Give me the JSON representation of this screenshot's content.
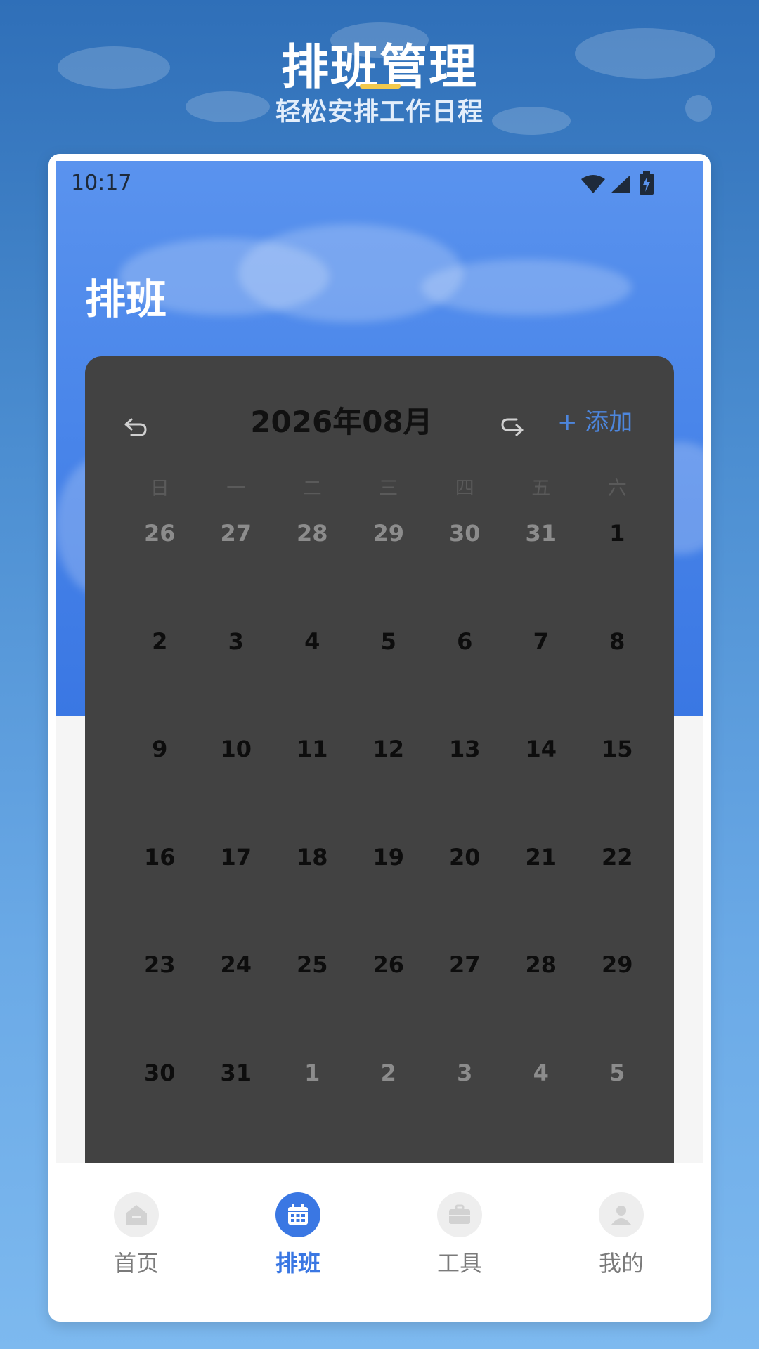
{
  "promo": {
    "title": "排班管理",
    "subtitle": "轻松安排工作日程"
  },
  "status_bar": {
    "time": "10:17",
    "icons": [
      "wifi-icon",
      "signal-icon",
      "battery-charging-icon"
    ]
  },
  "app": {
    "title": "排班"
  },
  "calendar": {
    "month_label": "2026年08月",
    "add_label": "+ 添加",
    "prev_icon": "undo-arrow-icon",
    "next_icon": "redo-arrow-icon",
    "weekdays": [
      "日",
      "一",
      "二",
      "三",
      "四",
      "五",
      "六"
    ],
    "weeks": [
      [
        {
          "d": "26",
          "out": true
        },
        {
          "d": "27",
          "out": true
        },
        {
          "d": "28",
          "out": true
        },
        {
          "d": "29",
          "out": true
        },
        {
          "d": "30",
          "out": true
        },
        {
          "d": "31",
          "out": true
        },
        {
          "d": "1",
          "out": false
        }
      ],
      [
        {
          "d": "2",
          "out": false
        },
        {
          "d": "3",
          "out": false
        },
        {
          "d": "4",
          "out": false
        },
        {
          "d": "5",
          "out": false
        },
        {
          "d": "6",
          "out": false
        },
        {
          "d": "7",
          "out": false
        },
        {
          "d": "8",
          "out": false
        }
      ],
      [
        {
          "d": "9",
          "out": false
        },
        {
          "d": "10",
          "out": false
        },
        {
          "d": "11",
          "out": false
        },
        {
          "d": "12",
          "out": false
        },
        {
          "d": "13",
          "out": false
        },
        {
          "d": "14",
          "out": false
        },
        {
          "d": "15",
          "out": false
        }
      ],
      [
        {
          "d": "16",
          "out": false
        },
        {
          "d": "17",
          "out": false
        },
        {
          "d": "18",
          "out": false
        },
        {
          "d": "19",
          "out": false
        },
        {
          "d": "20",
          "out": false
        },
        {
          "d": "21",
          "out": false
        },
        {
          "d": "22",
          "out": false
        }
      ],
      [
        {
          "d": "23",
          "out": false
        },
        {
          "d": "24",
          "out": false
        },
        {
          "d": "25",
          "out": false
        },
        {
          "d": "26",
          "out": false
        },
        {
          "d": "27",
          "out": false
        },
        {
          "d": "28",
          "out": false
        },
        {
          "d": "29",
          "out": false
        }
      ],
      [
        {
          "d": "30",
          "out": false
        },
        {
          "d": "31",
          "out": false
        },
        {
          "d": "1",
          "out": true
        },
        {
          "d": "2",
          "out": true
        },
        {
          "d": "3",
          "out": true
        },
        {
          "d": "4",
          "out": true
        },
        {
          "d": "5",
          "out": true
        }
      ]
    ]
  },
  "tabbar": {
    "tabs": [
      {
        "label": "首页",
        "icon": "home-icon",
        "active": false
      },
      {
        "label": "排班",
        "icon": "calendar-icon",
        "active": true
      },
      {
        "label": "工具",
        "icon": "toolbox-icon",
        "active": false
      },
      {
        "label": "我的",
        "icon": "person-icon",
        "active": false
      }
    ]
  },
  "colors": {
    "accent": "#3a77e3",
    "add_link": "#4d86dd",
    "calendar_bg": "#424242",
    "underline": "#f2c94c"
  }
}
